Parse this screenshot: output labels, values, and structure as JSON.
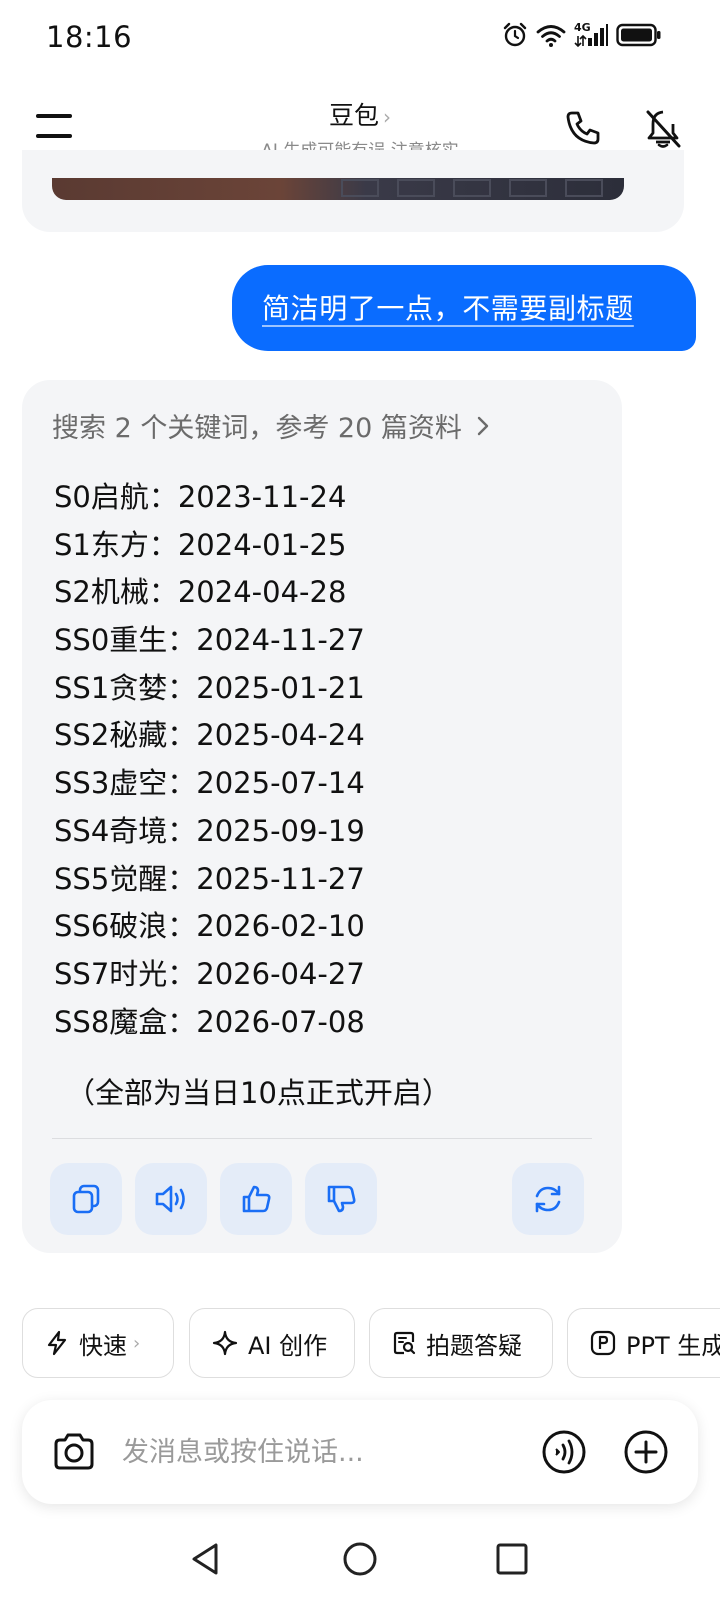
{
  "status_bar": {
    "time": "18:16",
    "network_label": "4G"
  },
  "header": {
    "title": "豆包",
    "title_chevron": "›",
    "subtitle": "AI 生成可能有误 注意核实"
  },
  "user_message": "简洁明了一点，不需要副标题",
  "answer": {
    "search_ref": "搜索 2 个关键词，参考 20 篇资料",
    "items": [
      "S0启航：2023-11-24",
      "S1东方：2024-01-25",
      "S2机械：2024-04-28",
      "SS0重生：2024-11-27",
      "SS1贪婪：2025-01-21",
      "SS2秘藏：2025-04-24",
      "SS3虚空：2025-07-14",
      "SS4奇境：2025-09-19",
      "SS5觉醒：2025-11-27",
      "SS6破浪：2026-02-10",
      "SS7时光：2026-04-27",
      "SS8魔盒：2026-07-08"
    ],
    "note": "（全部为当日10点正式开启）"
  },
  "chips": [
    {
      "label": "快速",
      "icon": "lightning-icon",
      "chevron": "›"
    },
    {
      "label": "AI 创作",
      "icon": "sparkle-icon"
    },
    {
      "label": "拍题答疑",
      "icon": "scan-question-icon"
    },
    {
      "label": "PPT 生成",
      "icon": "ppt-icon"
    }
  ],
  "input": {
    "placeholder": "发消息或按住说话..."
  },
  "colors": {
    "accent": "#0a6cff",
    "card_bg": "#f4f5f7",
    "action_bg": "#e4ecf8",
    "icon_blue": "#1a6ef5"
  }
}
